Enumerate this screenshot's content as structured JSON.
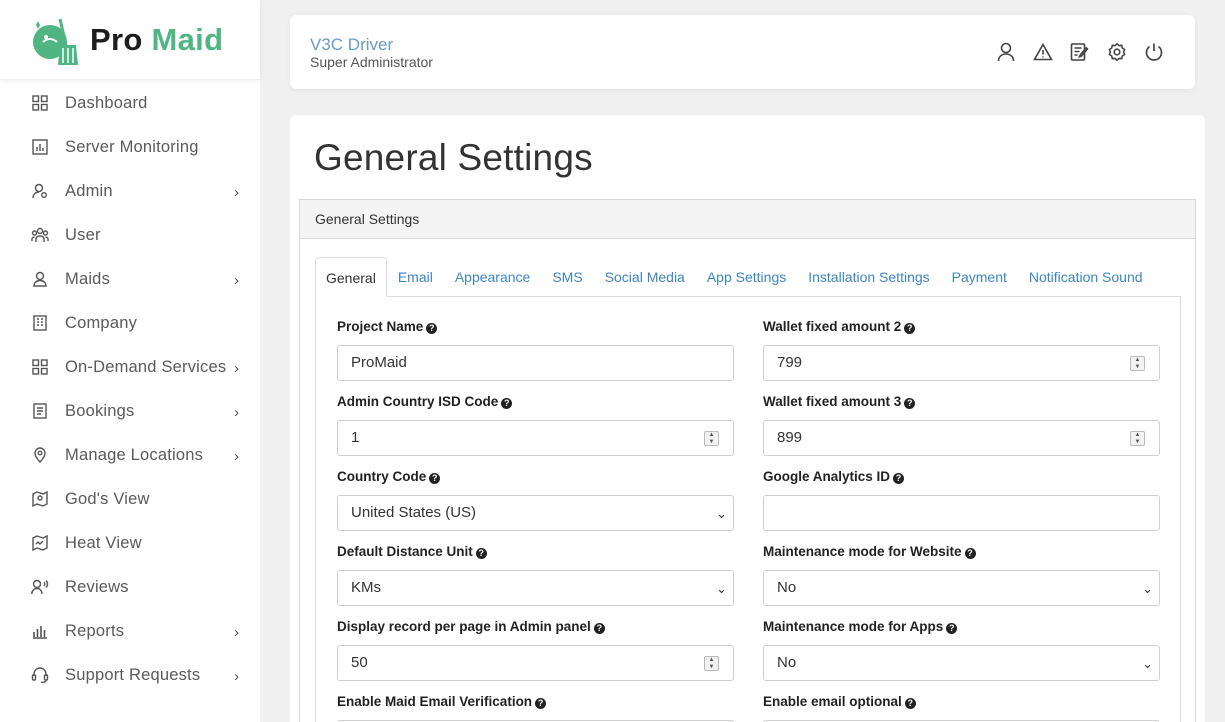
{
  "brand": {
    "pro": "Pro",
    "maid": "Maid",
    "green": "#4fb583"
  },
  "sidebar": {
    "items": [
      {
        "label": "Dashboard",
        "icon": "dashboard-icon",
        "has_children": false
      },
      {
        "label": "Server Monitoring",
        "icon": "chart-icon",
        "has_children": false
      },
      {
        "label": "Admin",
        "icon": "admin-icon",
        "has_children": true
      },
      {
        "label": "User",
        "icon": "users-icon",
        "has_children": false
      },
      {
        "label": "Maids",
        "icon": "person-icon",
        "has_children": true
      },
      {
        "label": "Company",
        "icon": "company-icon",
        "has_children": false
      },
      {
        "label": "On-Demand Services",
        "icon": "services-icon",
        "has_children": true
      },
      {
        "label": "Bookings",
        "icon": "bookings-icon",
        "has_children": true
      },
      {
        "label": "Manage Locations",
        "icon": "location-icon",
        "has_children": true
      },
      {
        "label": "God's View",
        "icon": "map-person-icon",
        "has_children": false
      },
      {
        "label": "Heat View",
        "icon": "heat-map-icon",
        "has_children": false
      },
      {
        "label": "Reviews",
        "icon": "reviews-icon",
        "has_children": false
      },
      {
        "label": "Reports",
        "icon": "reports-icon",
        "has_children": true
      },
      {
        "label": "Support Requests",
        "icon": "headset-icon",
        "has_children": true
      }
    ]
  },
  "header": {
    "title": "V3C Driver",
    "subtitle": "Super Administrator",
    "icons": [
      "profile-icon",
      "warning-icon",
      "edit-note-icon",
      "settings-icon",
      "power-icon"
    ]
  },
  "main": {
    "page_title": "General Settings",
    "panel_title": "General Settings",
    "tabs": [
      {
        "label": "General",
        "active": true
      },
      {
        "label": "Email"
      },
      {
        "label": "Appearance"
      },
      {
        "label": "SMS"
      },
      {
        "label": "Social Media"
      },
      {
        "label": "App Settings"
      },
      {
        "label": "Installation Settings"
      },
      {
        "label": "Payment"
      },
      {
        "label": "Notification Sound"
      }
    ],
    "fields": {
      "project_name": {
        "label": "Project Name",
        "value": "ProMaid"
      },
      "admin_isd": {
        "label": "Admin Country ISD Code",
        "value": "1"
      },
      "country_code": {
        "label": "Country Code",
        "value": "United States (US)"
      },
      "distance_unit": {
        "label": "Default Distance Unit",
        "value": "KMs"
      },
      "records_per_page": {
        "label": "Display record per page in Admin panel",
        "value": "50"
      },
      "maid_email_verif": {
        "label": "Enable Maid Email Verification",
        "value": ""
      },
      "wallet2": {
        "label": "Wallet fixed amount 2",
        "value": "799"
      },
      "wallet3": {
        "label": "Wallet fixed amount 3",
        "value": "899"
      },
      "ga_id": {
        "label": "Google Analytics ID",
        "value": ""
      },
      "maint_web": {
        "label": "Maintenance mode for Website",
        "value": "No"
      },
      "maint_apps": {
        "label": "Maintenance mode for Apps",
        "value": "No"
      },
      "email_optional": {
        "label": "Enable email optional",
        "value": ""
      }
    }
  }
}
